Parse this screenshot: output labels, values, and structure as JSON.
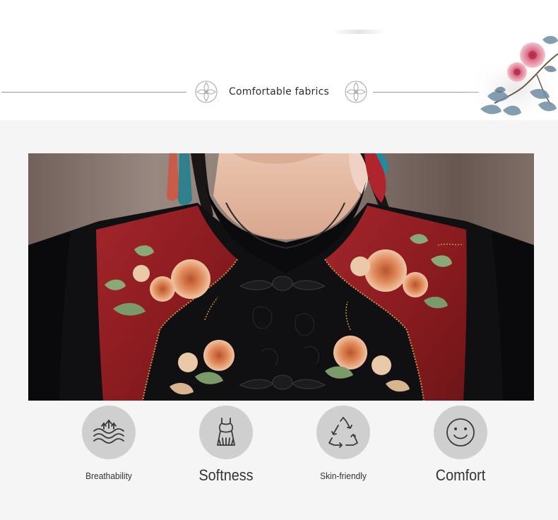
{
  "header": {
    "title": "Comfortable fabrics"
  },
  "features": [
    {
      "label": "Breathability",
      "icon": "waves-up-arrows-icon"
    },
    {
      "label": "Softness",
      "icon": "dress-icon"
    },
    {
      "label": "Skin-friendly",
      "icon": "recycle-icon"
    },
    {
      "label": "Comfort",
      "icon": "smiley-face-icon"
    }
  ],
  "colors": {
    "page_background": "#f5f5f5",
    "header_background": "#ffffff",
    "icon_circle": "#cfcfcf",
    "text": "#333333",
    "garment_black": "#101012",
    "panel_red": "#8c1c20"
  }
}
